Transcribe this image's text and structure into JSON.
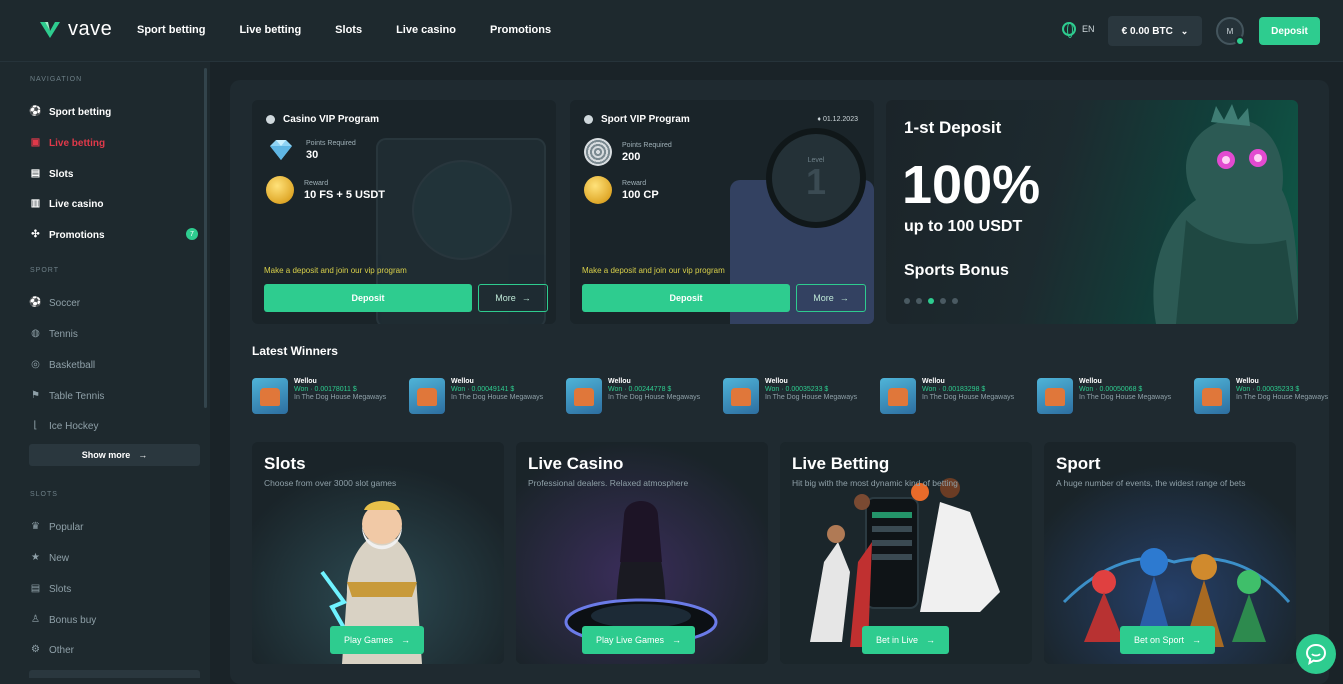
{
  "header": {
    "logo": "vave",
    "nav": [
      "Sport betting",
      "Live betting",
      "Slots",
      "Live casino",
      "Promotions"
    ],
    "lang": "EN",
    "balance": "€ 0.00 BTC",
    "avatar_initial": "M",
    "deposit_label": "Deposit"
  },
  "sidebar": {
    "navigation_label": "NAVIGATION",
    "navigation": [
      {
        "label": "Sport betting",
        "icon": "ball-icon"
      },
      {
        "label": "Live betting",
        "icon": "live-icon"
      },
      {
        "label": "Slots",
        "icon": "slots-icon"
      },
      {
        "label": "Live casino",
        "icon": "cards-icon"
      },
      {
        "label": "Promotions",
        "icon": "gift-icon"
      }
    ],
    "promotions_badge": "7",
    "sport_label": "SPORT",
    "sport": [
      {
        "label": "Soccer",
        "icon": "soccer-icon"
      },
      {
        "label": "Tennis",
        "icon": "tennis-icon"
      },
      {
        "label": "Basketball",
        "icon": "basketball-icon"
      },
      {
        "label": "Table Tennis",
        "icon": "table-tennis-icon"
      },
      {
        "label": "Ice Hockey",
        "icon": "hockey-icon"
      }
    ],
    "show_more": "Show more",
    "slots_label": "SLOTS",
    "slots": [
      {
        "label": "Popular",
        "icon": "crown-icon"
      },
      {
        "label": "New",
        "icon": "star-icon"
      },
      {
        "label": "Slots",
        "icon": "slots-icon"
      },
      {
        "label": "Bonus buy",
        "icon": "bonus-icon"
      },
      {
        "label": "Other",
        "icon": "other-icon"
      }
    ]
  },
  "vip": [
    {
      "title": "Casino VIP Program",
      "points_label": "Points Required",
      "points": "30",
      "reward_label": "Reward",
      "reward": "10 FS + 5 USDT",
      "note": "Make a deposit and join our vip program",
      "deposit": "Deposit",
      "more": "More"
    },
    {
      "title": "Sport VIP Program",
      "date": "01.12.2023",
      "points_label": "Points Required",
      "points": "200",
      "reward_label": "Reward",
      "reward": "100 CP",
      "level_label": "Level",
      "level": "1",
      "note": "Make a deposit and join our vip program",
      "deposit": "Deposit",
      "more": "More"
    }
  ],
  "banner": {
    "line1": "1-st Deposit",
    "line2": "100%",
    "line3": "up to 100 USDT",
    "line4": "Sports Bonus",
    "slide_count": 5,
    "active_slide": 3
  },
  "latest_winners": {
    "title": "Latest Winners",
    "items": [
      {
        "name": "Wellou",
        "won": "Won · 0.00178011 $",
        "game": "In The Dog House Megaways"
      },
      {
        "name": "Wellou",
        "won": "Won · 0.00049141 $",
        "game": "In The Dog House Megaways"
      },
      {
        "name": "Wellou",
        "won": "Won · 0.00244778 $",
        "game": "In The Dog House Megaways"
      },
      {
        "name": "Wellou",
        "won": "Won · 0.00035233 $",
        "game": "In The Dog House Megaways"
      },
      {
        "name": "Wellou",
        "won": "Won · 0.00183298 $",
        "game": "In The Dog House Megaways"
      },
      {
        "name": "Wellou",
        "won": "Won · 0.00050068 $",
        "game": "In The Dog House Megaways"
      },
      {
        "name": "Wellou",
        "won": "Won · 0.00035233 $",
        "game": "In The Dog House Megaways"
      }
    ]
  },
  "categories": [
    {
      "title": "Slots",
      "subtitle": "Choose from over 3000 slot games",
      "button": "Play Games"
    },
    {
      "title": "Live Casino",
      "subtitle": "Professional dealers. Relaxed atmosphere",
      "button": "Play Live Games"
    },
    {
      "title": "Live Betting",
      "subtitle": "Hit big with the most dynamic kind of betting",
      "button": "Bet in Live"
    },
    {
      "title": "Sport",
      "subtitle": "A huge number of events, the widest range of bets",
      "button": "Bet on Sport"
    }
  ],
  "colors": {
    "accent": "#2ecc8f",
    "live": "#e0394a",
    "background": "#1a2328",
    "note": "#d9d04a"
  }
}
